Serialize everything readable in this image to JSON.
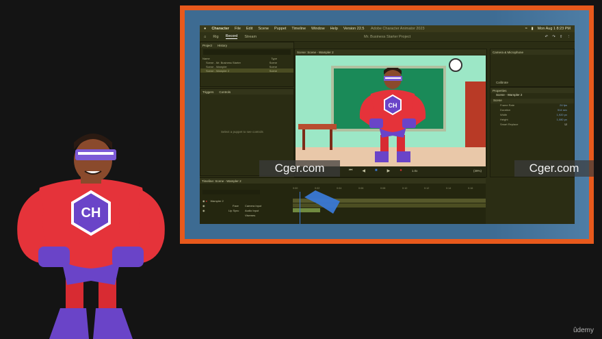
{
  "mac_menu": {
    "apple": "",
    "app": "Character",
    "items": [
      "File",
      "Edit",
      "Scene",
      "Puppet",
      "Timeline",
      "Window",
      "Help",
      "Version 22.5"
    ],
    "window_title": "Adobe Character Animator 2023",
    "clock": "Mon Aug 1  8:23 PM"
  },
  "app_tabs": [
    "Rig",
    "Record",
    "Stream"
  ],
  "project_name": "Mr. Business Starter Project",
  "project_panel": {
    "tabs": [
      "Project",
      "History"
    ],
    "columns": [
      "Name",
      "Type"
    ],
    "rows": [
      {
        "name": "Scene - Mr. Business Starter",
        "type": "Scene"
      },
      {
        "name": "Scene - Wampler",
        "type": "Scene"
      },
      {
        "name": "Scene - Wampler 2",
        "type": "Scene"
      }
    ]
  },
  "controls_panel": {
    "tabs": [
      "Triggers",
      "Controls"
    ],
    "empty_message": "Select a puppet to see controls"
  },
  "scene_panel": {
    "title": "Scene: Scene - Wampler 2",
    "zoom": "(39%)",
    "rate": "1.0x"
  },
  "camera_panel": {
    "title": "Camera & Microphone",
    "calibrate": "Calibrate"
  },
  "properties_panel": {
    "title": "Properties",
    "scene_name": "Scene - Wampler 2",
    "section": "Scene",
    "fields": [
      {
        "label": "Frame Rate",
        "value": "24 fps"
      },
      {
        "label": "Duration",
        "value": "514 sec"
      },
      {
        "label": "Width",
        "value": "1,920 px"
      },
      {
        "label": "Height",
        "value": "1,080 px"
      },
      {
        "label": "Smart Replace",
        "value": ""
      }
    ]
  },
  "timeline": {
    "title": "Timeline: Scene - Wampler 2",
    "tracks": [
      {
        "name": "Wampler 2",
        "input": ""
      },
      {
        "name": "Face",
        "input": "Camera Input"
      },
      {
        "name": "Lip Sync",
        "input": "Audio Input"
      },
      {
        "name": "",
        "input": "Visemes"
      }
    ],
    "ruler_labels": [
      "0:00",
      "0:02",
      "0:04",
      "0:06",
      "0:08",
      "0:10",
      "0:12",
      "0:14",
      "0:16"
    ]
  },
  "watermark_text": "Cger.com",
  "brand": {
    "udemy": "ûdemy"
  },
  "colors": {
    "frame": "#e8591c",
    "backdrop": "#3d6b92",
    "hero_red": "#e5333a",
    "hero_purple": "#6a44c8"
  }
}
